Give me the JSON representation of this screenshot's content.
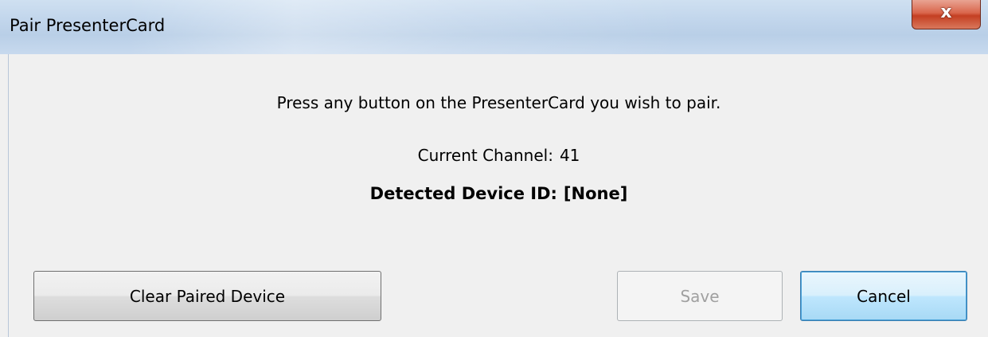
{
  "window": {
    "title": "Pair PresenterCard",
    "close_glyph": "x"
  },
  "dialog": {
    "instruction": "Press any button on the PresenterCard you wish to pair.",
    "channel_label": "Current Channel:",
    "channel_value": "41",
    "device_id_label": "Detected Device ID:",
    "device_id_value": "[None]"
  },
  "buttons": {
    "clear_label": "Clear Paired Device",
    "save_label": "Save",
    "save_enabled": false,
    "cancel_label": "Cancel"
  },
  "colors": {
    "titlebar": "#c2d6ec",
    "close_button": "#c43f22",
    "dialog_background": "#f0f0f0",
    "disabled_text": "#a0a0a0",
    "focus_border": "#3c7fb1"
  }
}
